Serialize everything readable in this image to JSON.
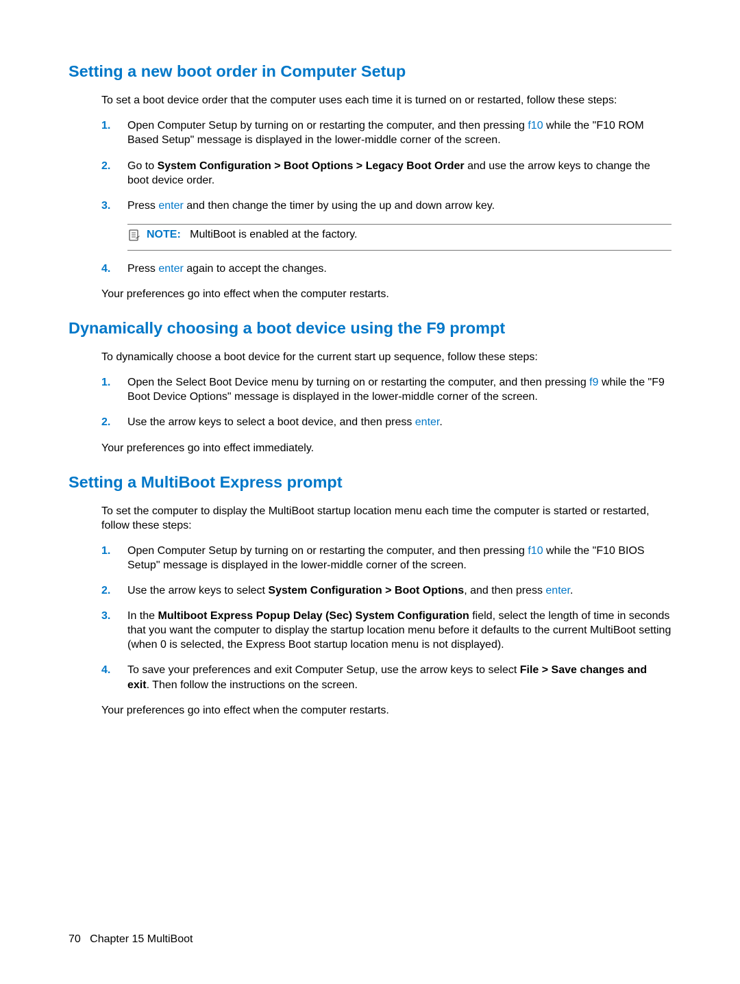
{
  "section1": {
    "heading": "Setting a new boot order in Computer Setup",
    "intro": "To set a boot device order that the computer uses each time it is turned on or restarted, follow these steps:",
    "step1_pre": "Open Computer Setup by turning on or restarting the computer, and then pressing ",
    "step1_key": "f10",
    "step1_post": " while the \"F10 ROM Based Setup\" message is displayed in the lower-middle corner of the screen.",
    "step2_pre": "Go to ",
    "step2_bold": "System Configuration > Boot Options > Legacy Boot Order",
    "step2_post": " and use the arrow keys to change the boot device order.",
    "step3_pre": "Press ",
    "step3_key": "enter",
    "step3_post": " and then change the timer by using the up and down arrow key.",
    "note_label": "NOTE:",
    "note_text": "MultiBoot is enabled at the factory.",
    "step4_pre": "Press ",
    "step4_key": "enter",
    "step4_post": " again to accept the changes.",
    "outro": "Your preferences go into effect when the computer restarts."
  },
  "section2": {
    "heading": "Dynamically choosing a boot device using the F9 prompt",
    "intro": "To dynamically choose a boot device for the current start up sequence, follow these steps:",
    "step1_pre": "Open the Select Boot Device menu by turning on or restarting the computer, and then pressing ",
    "step1_key": "f9",
    "step1_post": " while the \"F9 Boot Device Options\" message is displayed in the lower-middle corner of the screen.",
    "step2_pre": "Use the arrow keys to select a boot device, and then press ",
    "step2_key": "enter",
    "step2_post": ".",
    "outro": "Your preferences go into effect immediately."
  },
  "section3": {
    "heading": "Setting a MultiBoot Express prompt",
    "intro": "To set the computer to display the MultiBoot startup location menu each time the computer is started or restarted, follow these steps:",
    "step1_pre": "Open Computer Setup by turning on or restarting the computer, and then pressing ",
    "step1_key": "f10",
    "step1_post": " while the \"F10 BIOS Setup\" message is displayed in the lower-middle corner of the screen.",
    "step2_pre": "Use the arrow keys to select ",
    "step2_bold": "System Configuration > Boot Options",
    "step2_mid": ", and then press ",
    "step2_key": "enter",
    "step2_post": ".",
    "step3_pre": "In the ",
    "step3_bold": "Multiboot Express Popup Delay (Sec) System Configuration",
    "step3_post": " field, select the length of time in seconds that you want the computer to display the startup location menu before it defaults to the current MultiBoot setting (when 0 is selected, the Express Boot startup location menu is not displayed).",
    "step4_pre": "To save your preferences and exit Computer Setup, use the arrow keys to select ",
    "step4_bold": "File > Save changes and exit",
    "step4_post": ". Then follow the instructions on the screen.",
    "outro": "Your preferences go into effect when the computer restarts."
  },
  "footer": {
    "page": "70",
    "chapter": "Chapter 15   MultiBoot"
  },
  "nums": {
    "n1": "1.",
    "n2": "2.",
    "n3": "3.",
    "n4": "4."
  }
}
